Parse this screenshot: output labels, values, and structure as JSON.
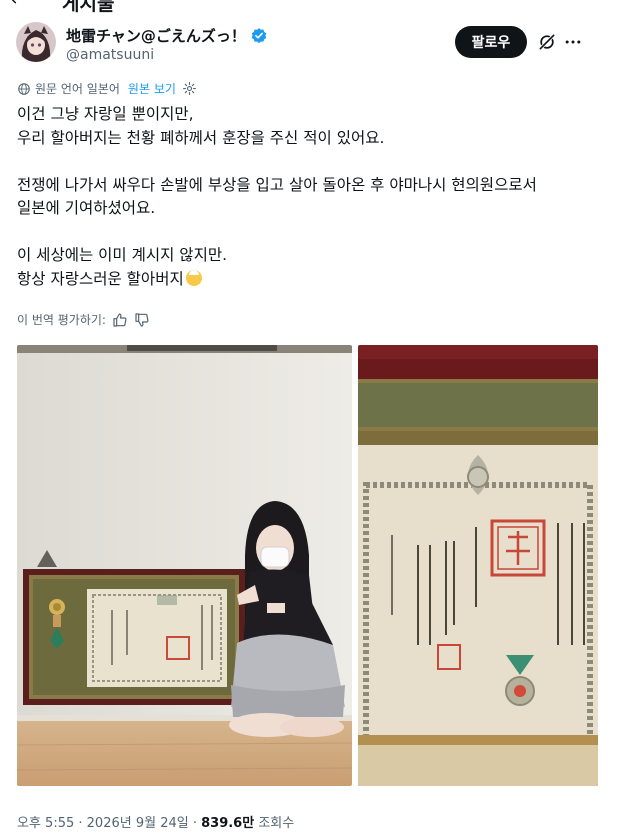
{
  "header": {
    "title": "게시물"
  },
  "author": {
    "display_name": "地雷チャン@ごえんズっ！",
    "handle": "@amatsuuni"
  },
  "actions": {
    "follow_label": "팔로우"
  },
  "translation": {
    "language_note": "원문 언어 일본어",
    "show_original_label": "원본 보기"
  },
  "tweet": {
    "lines": [
      "이건 그냥 자랑일 뿐이지만,",
      "우리 할아버지는 천황 폐하께서 훈장을 주신 적이 있어요.",
      "",
      "전쟁에 나가서 싸우다 손발에 부상을 입고 살아 돌아온 후 야마나시 현의원으로서",
      "일본에 기여하셨어요.",
      "",
      "이 세상에는 이미 계시지 않지만.",
      "항상 자랑스러운 할아버지"
    ]
  },
  "rate_translation": {
    "label": "이 번역 평가하기:"
  },
  "meta": {
    "time": "오후 5:55",
    "date": "2026년 9월 24일",
    "separator": " · ",
    "views_count": "839.6만",
    "views_label": "조회수"
  },
  "icons": {
    "back": "arrow-left-icon",
    "verified": "verified-badge-icon",
    "grok": "grok-icon",
    "more": "more-icon",
    "globe": "globe-icon",
    "settings": "settings-icon",
    "thumbs_up": "thumbs-up-icon",
    "thumbs_down": "thumbs-down-icon",
    "emoji": "face-emoji-icon"
  },
  "colors": {
    "accent": "#1d9bf0",
    "text": "#0f1419",
    "secondary": "#536471",
    "button_bg": "#0f1419"
  }
}
